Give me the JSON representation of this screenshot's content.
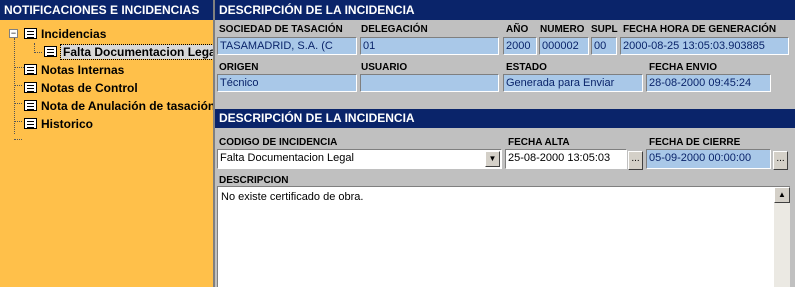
{
  "tree": {
    "title": "NOTIFICACIONES E INCIDENCIAS",
    "items": [
      {
        "label": "Incidencias",
        "expander": "−"
      },
      {
        "label": "Falta Documentacion Legal"
      },
      {
        "label": "Notas Internas"
      },
      {
        "label": "Notas de Control"
      },
      {
        "label": "Nota de Anulación de tasación"
      },
      {
        "label": "Historico"
      }
    ]
  },
  "section1": {
    "title": "DESCRIPCIÓN DE LA INCIDENCIA",
    "fields": {
      "sociedad": {
        "label": "SOCIEDAD DE TASACIÓN",
        "value": "TASAMADRID, S.A.  (C"
      },
      "delegacion": {
        "label": "DELEGACIÓN",
        "value": "01"
      },
      "anio": {
        "label": "AÑO",
        "value": "2000"
      },
      "numero": {
        "label": "NUMERO",
        "value": "000002"
      },
      "supl": {
        "label": "SUPL",
        "value": "00"
      },
      "fecha_generacion": {
        "label": "FECHA HORA DE GENERACIÓN",
        "value": "2000-08-25 13:05:03.903885"
      },
      "origen": {
        "label": "ORIGEN",
        "value": "Técnico"
      },
      "usuario": {
        "label": "USUARIO",
        "value": ""
      },
      "estado": {
        "label": "ESTADO",
        "value": "Generada para Enviar"
      },
      "fecha_envio": {
        "label": "FECHA ENVIO",
        "value": "28-08-2000 09:45:24"
      }
    }
  },
  "section2": {
    "title": "DESCRIPCIÓN DE LA INCIDENCIA",
    "fields": {
      "codigo": {
        "label": "CODIGO DE INCIDENCIA",
        "value": "Falta Documentacion Legal"
      },
      "fecha_alta": {
        "label": "FECHA ALTA",
        "value": "25-08-2000 13:05:03"
      },
      "fecha_cierre": {
        "label": "FECHA DE CIERRE",
        "value": "05-09-2000 00:00:00"
      },
      "descripcion": {
        "label": "DESCRIPCION",
        "value": "No existe certificado de obra."
      }
    },
    "ellipsis": "...",
    "dropdown_arrow": "▼",
    "scroll_up": "▲"
  }
}
